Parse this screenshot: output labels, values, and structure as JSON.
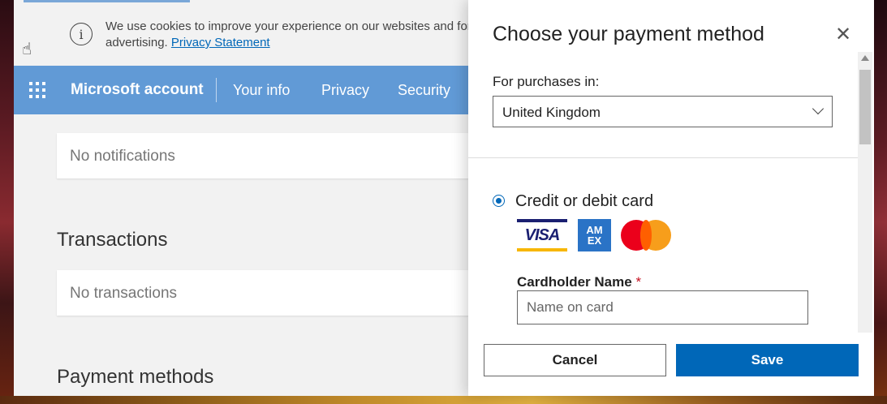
{
  "cookie_banner": {
    "text": "We use cookies to improve your experience on our websites and for advertising.",
    "link_label": "Privacy Statement"
  },
  "nav": {
    "brand": "Microsoft account",
    "links": [
      "Your info",
      "Privacy",
      "Security"
    ]
  },
  "main": {
    "notifications_empty": "No notifications",
    "transactions_title": "Transactions",
    "transactions_empty": "No transactions",
    "payment_methods_title": "Payment methods"
  },
  "payment_panel": {
    "title": "Choose your payment method",
    "region_label": "For purchases in:",
    "region_value": "United Kingdom",
    "method_label": "Credit or debit card",
    "card_brands": [
      "VISA",
      "AMEX",
      "Mastercard"
    ],
    "cardholder_label": "Cardholder Name",
    "required_marker": "*",
    "cardholder_placeholder": "Name on card",
    "cancel_label": "Cancel",
    "save_label": "Save"
  },
  "colors": {
    "nav_bg": "#619ad6",
    "primary_button": "#0067b8",
    "required": "#c50f1f"
  }
}
